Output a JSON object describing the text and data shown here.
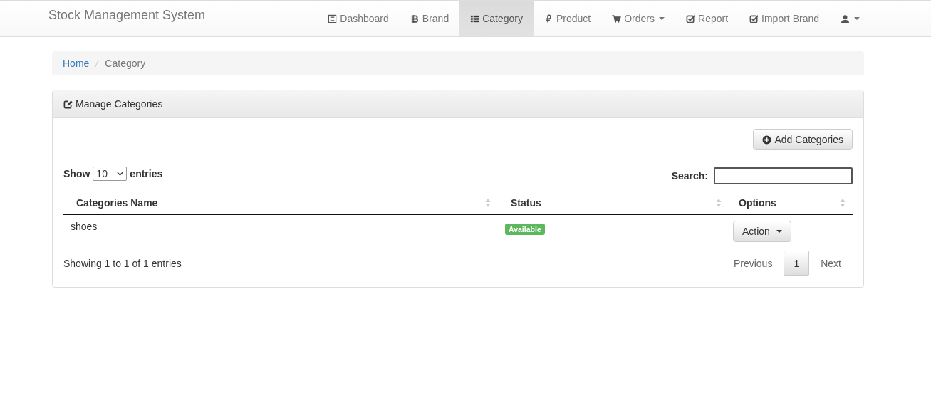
{
  "navbar": {
    "brand": "Stock Management System",
    "items": [
      {
        "label": "Dashboard",
        "selected": false,
        "has_caret": false
      },
      {
        "label": "Brand",
        "selected": false,
        "has_caret": false
      },
      {
        "label": "Category",
        "selected": true,
        "has_caret": false
      },
      {
        "label": "Product",
        "selected": false,
        "has_caret": false
      },
      {
        "label": "Orders",
        "selected": false,
        "has_caret": true
      },
      {
        "label": "Report",
        "selected": false,
        "has_caret": false
      },
      {
        "label": "Import Brand",
        "selected": false,
        "has_caret": false
      },
      {
        "selected": false,
        "has_caret": true
      }
    ]
  },
  "breadcrumb": [
    {
      "label": "Home",
      "link": true
    },
    {
      "label": "Category",
      "link": false
    }
  ],
  "panel": {
    "title": "Manage Categories",
    "add_button": "Add Categories",
    "length": {
      "before": "Show",
      "value": "10",
      "after": "entries"
    },
    "search": {
      "label": "Search:"
    },
    "table": {
      "columns": [
        "Categories Name",
        "Status",
        "Options"
      ],
      "rows": [
        {
          "name": "shoes",
          "status": "Available",
          "color": "#5cb85c",
          "action": "Action"
        }
      ]
    },
    "info": "Showing 1 to 1 of 1 entries",
    "pagination": {
      "previous": "Previous",
      "pages": [
        {
          "label": "1",
          "selected": true
        }
      ],
      "next": "Next"
    }
  }
}
